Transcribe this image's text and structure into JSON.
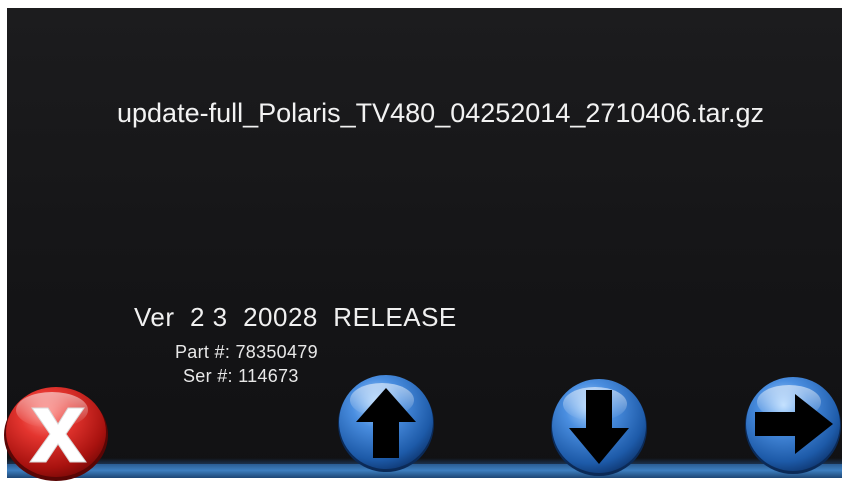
{
  "screen": {
    "filename": "update-full_Polaris_TV480_04252014_2710406.tar.gz",
    "version_line": "Ver  2 3  20028  RELEASE",
    "part": {
      "label": "Part #:",
      "value": "78350479"
    },
    "serial": {
      "label": "Ser #:",
      "value": "114673"
    }
  },
  "buttons": {
    "cancel": {
      "icon": "x-icon",
      "color": "#d8282a"
    },
    "up": {
      "icon": "arrow-up-icon",
      "color": "#3f7fd0"
    },
    "down": {
      "icon": "arrow-down-icon",
      "color": "#3f7fd0"
    },
    "next": {
      "icon": "arrow-right-icon",
      "color": "#3f7fd0"
    }
  },
  "colors": {
    "background": "#151517",
    "text": "#f2f2f2",
    "bar": "#3e7fc0"
  }
}
